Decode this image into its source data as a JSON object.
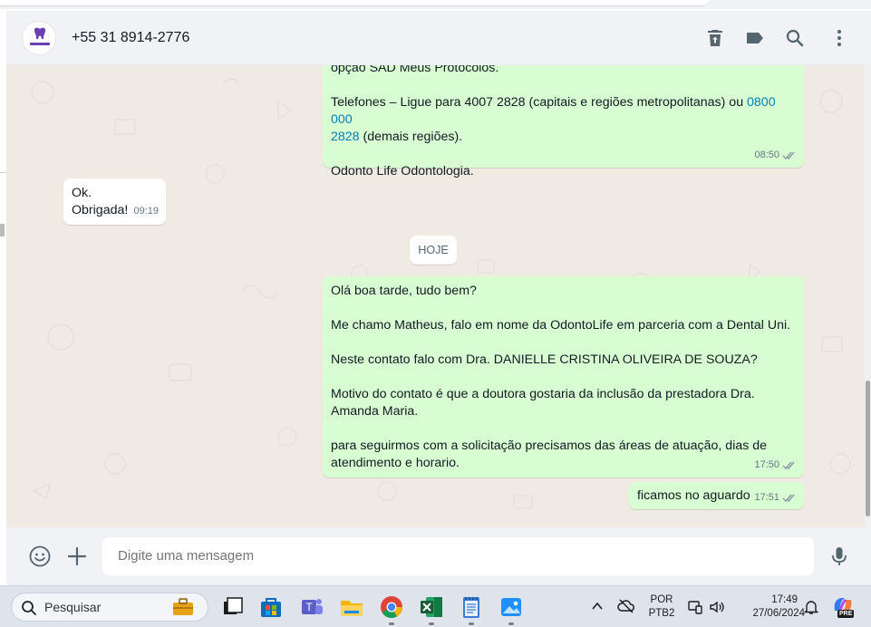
{
  "contact": {
    "name": "+55 31 8914-2776",
    "avatar_text": "ODONTOLOGIA"
  },
  "header_icons": [
    "trash-icon",
    "label-icon",
    "search-icon",
    "menu-icon"
  ],
  "messages": {
    "m1": {
      "line1": "opção SAD Meus Protocolos.",
      "phones_prefix": "Telefones – Ligue para 4007 2828 (capitais e regiões metropolitanas) ou ",
      "phones_link_a": "0800 000",
      "phones_link_b": "2828",
      "phones_suffix": " (demais regiões).",
      "signature": "Odonto Life Odontologia.",
      "time": "08:50"
    },
    "m2": {
      "line1": "Ok.",
      "line2": "Obrigada!",
      "time": "09:19"
    },
    "date_chip": "HOJE",
    "m3": {
      "p1": "Olá boa tarde, tudo bem?",
      "p2": "Me chamo Matheus, falo em nome da OdontoLife em parceria com a Dental Uni.",
      "p3": "Neste contato falo com Dra. DANIELLE CRISTINA OLIVEIRA DE SOUZA?",
      "p4a": "Motivo do contato é que a doutora gostaria da inclusão da prestadora Dra.",
      "p4b": "Amanda Maria.",
      "p5a": "para seguirmos com a solicitação precisamos das áreas de atuação, dias de",
      "p5b": "atendimento e horario.",
      "time": "17:50"
    },
    "m4": {
      "text": "ficamos no aguardo",
      "time": "17:51"
    }
  },
  "composer": {
    "placeholder": "Digite uma mensagem"
  },
  "taskbar": {
    "search_placeholder": "Pesquisar",
    "lang_top": "POR",
    "lang_bottom": "PTB2",
    "time": "17:49",
    "date": "27/06/2024",
    "copilot_badge": "PRE"
  },
  "colors": {
    "outgoing_bubble": "#d9fdd3",
    "incoming_bubble": "#ffffff",
    "chat_background": "#efeae2",
    "header_background": "#f0f2f5",
    "link": "#027eb5"
  }
}
